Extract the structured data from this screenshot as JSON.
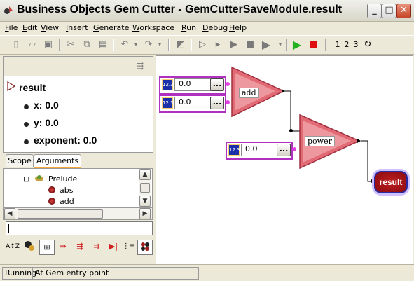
{
  "window": {
    "title": "Business Objects Gem Cutter - GemCutterSaveModule.result",
    "minimize": "_",
    "maximize": "□",
    "close": "✕"
  },
  "menu": [
    "File",
    "Edit",
    "View",
    "Insert",
    "Generate",
    "Workspace",
    "Run",
    "Debug",
    "Help"
  ],
  "toolbar": {
    "numbers": [
      "1",
      "2",
      "3"
    ],
    "icons": [
      "new-icon",
      "open-icon",
      "save-icon",
      "cut-icon",
      "copy-icon",
      "paste-icon",
      "undo-icon",
      "redo-icon",
      "eraser-icon",
      "step-icon",
      "play-outline-icon",
      "stop-outline-icon",
      "run-icon",
      "play-green-icon",
      "stop-red-icon",
      "refresh-icon"
    ]
  },
  "explorer": {
    "root": "result",
    "args": [
      "x: 0.0",
      "y: 0.0",
      "exponent: 0.0"
    ]
  },
  "tabs": [
    "Scope",
    "Arguments"
  ],
  "tree": {
    "module": "Prelude",
    "items": [
      "abs",
      "add"
    ],
    "expander": "⊟"
  },
  "canvas": {
    "inputs": [
      {
        "badge": "12.3",
        "value": "0.0",
        "button": "..."
      },
      {
        "badge": "12.3",
        "value": "0.0",
        "button": "..."
      },
      {
        "badge": "12.3",
        "value": "0.0",
        "button": "..."
      }
    ],
    "gems": [
      "add",
      "power"
    ],
    "result": "result"
  },
  "colors": {
    "gem_fill": "#e06070",
    "port": "#e040e0",
    "badge": "#1a2fa8",
    "input_border": "#b030c0",
    "result": "#c02020"
  },
  "status": {
    "state": "Running",
    "message": "At Gem entry point"
  }
}
